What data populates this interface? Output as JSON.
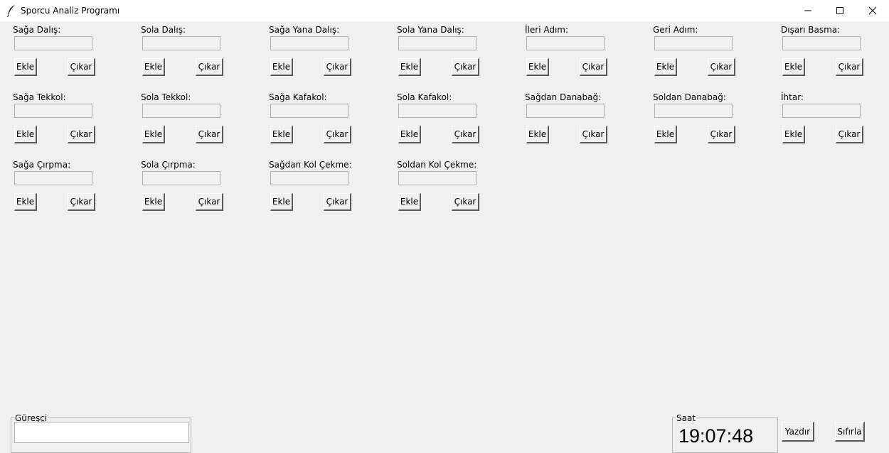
{
  "window": {
    "title": "Sporcu Analiz Programı",
    "icon": "feather-icon",
    "controls": [
      "minimize-icon",
      "maximize-icon",
      "close-icon"
    ]
  },
  "moves": [
    {
      "label": "Sağa Dalış:",
      "value": "",
      "add_label": "Ekle",
      "remove_label": "Çıkar"
    },
    {
      "label": "Sola Dalış:",
      "value": "",
      "add_label": "Ekle",
      "remove_label": "Çıkar"
    },
    {
      "label": "Sağa Yana Dalış:",
      "value": "",
      "add_label": "Ekle",
      "remove_label": "Çıkar"
    },
    {
      "label": "Sola Yana Dalış:",
      "value": "",
      "add_label": "Ekle",
      "remove_label": "Çıkar"
    },
    {
      "label": "İleri Adım:",
      "value": "",
      "add_label": "Ekle",
      "remove_label": "Çıkar"
    },
    {
      "label": "Geri Adım:",
      "value": "",
      "add_label": "Ekle",
      "remove_label": "Çıkar"
    },
    {
      "label": "Dışarı Basma:",
      "value": "",
      "add_label": "Ekle",
      "remove_label": "Çıkar"
    },
    {
      "label": "Sağa Tekkol:",
      "value": "",
      "add_label": "Ekle",
      "remove_label": "Çıkar"
    },
    {
      "label": "Sola Tekkol:",
      "value": "",
      "add_label": "Ekle",
      "remove_label": "Çıkar"
    },
    {
      "label": "Sağa Kafakol:",
      "value": "",
      "add_label": "Ekle",
      "remove_label": "Çıkar"
    },
    {
      "label": "Sola Kafakol:",
      "value": "",
      "add_label": "Ekle",
      "remove_label": "Çıkar"
    },
    {
      "label": "Sağdan Danabağ:",
      "value": "",
      "add_label": "Ekle",
      "remove_label": "Çıkar"
    },
    {
      "label": "Soldan Danabağ:",
      "value": "",
      "add_label": "Ekle",
      "remove_label": "Çıkar"
    },
    {
      "label": "İhtar:",
      "value": "",
      "add_label": "Ekle",
      "remove_label": "Çıkar"
    },
    {
      "label": "Sağa Çırpma:",
      "value": "",
      "add_label": "Ekle",
      "remove_label": "Çıkar"
    },
    {
      "label": "Sola Çırpma:",
      "value": "",
      "add_label": "Ekle",
      "remove_label": "Çıkar"
    },
    {
      "label": "Sağdan Kol Çekme:",
      "value": "",
      "add_label": "Ekle",
      "remove_label": "Çıkar"
    },
    {
      "label": "Soldan Kol Çekme:",
      "value": "",
      "add_label": "Ekle",
      "remove_label": "Çıkar"
    }
  ],
  "wrestler": {
    "label": "Güreşçi",
    "value": ""
  },
  "clock": {
    "label": "Saat",
    "time": "19:07:48"
  },
  "actions": {
    "print_label": "Yazdır",
    "reset_label": "Sıfırla"
  }
}
